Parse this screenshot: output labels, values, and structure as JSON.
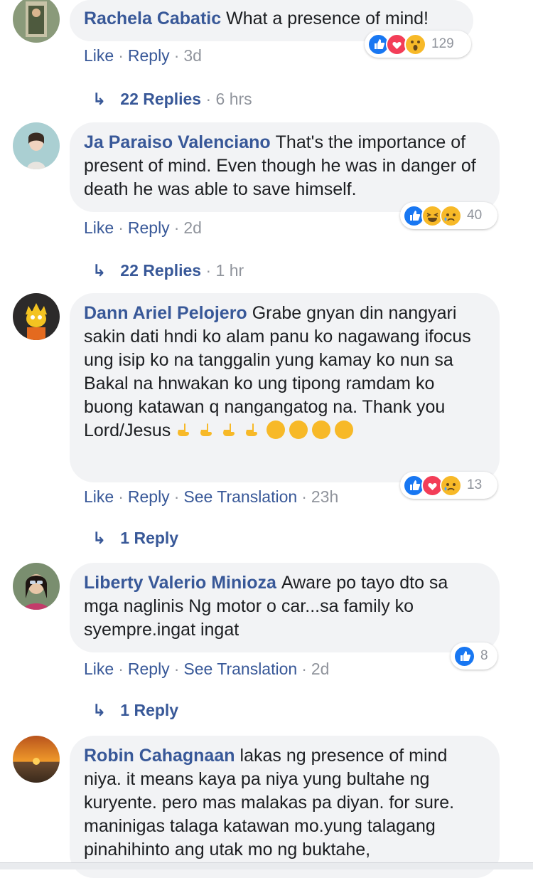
{
  "comments": [
    {
      "author": "Rachela Cabatic",
      "text": "What a presence of mind!",
      "actions": {
        "like": "Like",
        "reply": "Reply",
        "time": "3d"
      },
      "reactions": {
        "icons": [
          "like-icon",
          "love-icon",
          "wow-icon"
        ],
        "count": "129"
      },
      "replies": {
        "label": "22 Replies",
        "time": "6 hrs"
      }
    },
    {
      "author": "Ja Paraiso Valenciano",
      "text": "That's the importance of present of mind. Even though he was in danger of death he was able to save himself.",
      "actions": {
        "like": "Like",
        "reply": "Reply",
        "time": "2d"
      },
      "reactions": {
        "icons": [
          "like-icon",
          "haha-icon",
          "sad-icon"
        ],
        "count": "40"
      },
      "replies": {
        "label": "22 Replies",
        "time": "1 hr"
      }
    },
    {
      "author": "Dann Ariel Pelojero",
      "text": "Grabe gnyan din nangyari sakin dati hndi ko alam panu ko nagawang ifocus ung isip ko na tanggalin yung kamay ko nun sa Bakal na hnwakan ko ung tipong ramdam ko buong katawan q nangangatog na. Thank you Lord/Jesus",
      "actions": {
        "like": "Like",
        "reply": "Reply",
        "translate": "See Translation",
        "time": "23h"
      },
      "reactions": {
        "icons": [
          "like-icon",
          "love-icon",
          "sad-icon"
        ],
        "count": "13"
      },
      "replies": {
        "label": "1 Reply"
      }
    },
    {
      "author": "Liberty Valerio Minioza",
      "text": "Aware po tayo dto sa mga naglinis Ng motor o car...sa family ko syempre.ingat ingat",
      "actions": {
        "like": "Like",
        "reply": "Reply",
        "translate": "See Translation",
        "time": "2d"
      },
      "reactions": {
        "icons": [
          "like-icon"
        ],
        "count": "8"
      },
      "replies": {
        "label": "1 Reply"
      }
    },
    {
      "author": "Robin Cahagnaan",
      "text": "lakas ng presence of mind niya. it means kaya pa niya yung bultahe ng kuryente. pero mas malakas pa diyan. for sure. maninigas talaga katawan mo.yung talagang pinahihinto ang utak mo ng buktahe,"
    }
  ]
}
